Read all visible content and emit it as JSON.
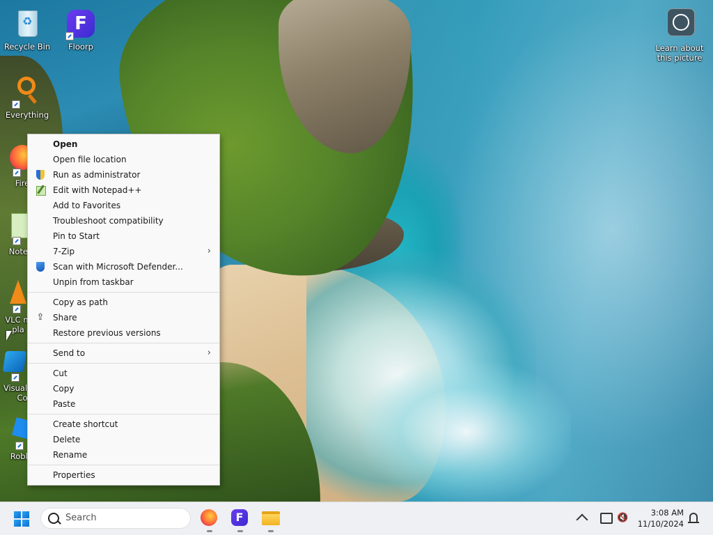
{
  "desktop": {
    "icons": [
      {
        "label": "Recycle Bin",
        "icon": "recycle-bin-icon"
      },
      {
        "label": "Floorp",
        "icon": "floorp-icon"
      },
      {
        "label": "Everything",
        "icon": "everything-search-icon"
      },
      {
        "label": "Fire",
        "icon": "firefox-icon"
      },
      {
        "label": "Notep",
        "icon": "notepad-plus-plus-icon"
      },
      {
        "label": "VLC m",
        "label2": "pla",
        "icon": "vlc-icon"
      },
      {
        "label": "Visual",
        "label2": "Co",
        "icon": "visual-studio-code-icon"
      },
      {
        "label": "Roblox",
        "icon": "roblox-icon"
      }
    ],
    "learn": {
      "line1": "Learn about",
      "line2": "this picture",
      "icon": "learn-about-picture-icon"
    }
  },
  "context_menu": {
    "items": [
      {
        "label": "Open",
        "bold": true
      },
      {
        "label": "Open file location"
      },
      {
        "label": "Run as administrator",
        "icon": "uac-shield-icon"
      },
      {
        "label": "Edit with Notepad++",
        "icon": "notepad-plus-plus-icon"
      },
      {
        "label": "Add to Favorites"
      },
      {
        "label": "Troubleshoot compatibility"
      },
      {
        "label": "Pin to Start"
      },
      {
        "label": "7-Zip",
        "submenu": true
      },
      {
        "label": "Scan with Microsoft Defender...",
        "icon": "defender-shield-icon"
      },
      {
        "label": "Unpin from taskbar"
      },
      {
        "label": "Copy as path"
      },
      {
        "label": "Share",
        "icon": "share-icon"
      },
      {
        "label": "Restore previous versions"
      },
      {
        "label": "Send to",
        "submenu": true
      },
      {
        "label": "Cut"
      },
      {
        "label": "Copy"
      },
      {
        "label": "Paste"
      },
      {
        "label": "Create shortcut"
      },
      {
        "label": "Delete"
      },
      {
        "label": "Rename"
      },
      {
        "label": "Properties"
      }
    ],
    "submenu_arrow": "›"
  },
  "taskbar": {
    "search_placeholder": "Search",
    "floorp_letter": "F",
    "apps": [
      "firefox-icon",
      "floorp-icon",
      "file-explorer-icon"
    ],
    "time": "3:08 AM",
    "date": "11/10/2024",
    "volume_glyph": "🔇"
  }
}
